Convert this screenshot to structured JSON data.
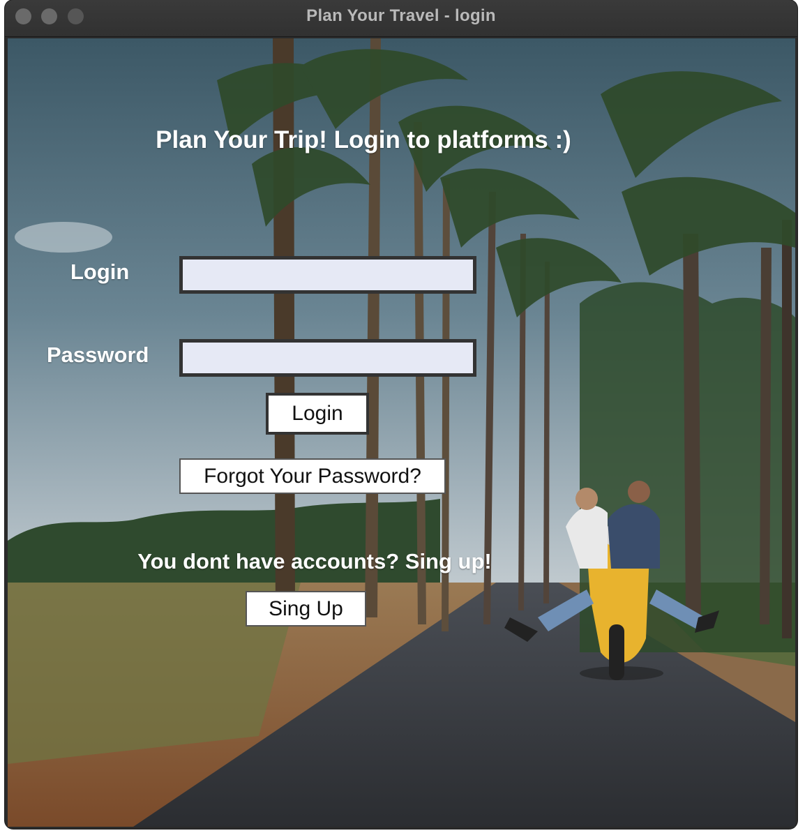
{
  "window": {
    "title": "Plan Your Travel - login"
  },
  "main": {
    "heading": "Plan Your Trip! Login to platforms :)",
    "login_label": "Login",
    "password_label": "Password",
    "login_value": "",
    "password_value": "",
    "login_button": "Login",
    "forgot_button": "Forgot Your Password?",
    "signup_prompt": "You dont have accounts? Sing up!",
    "signup_button": "Sing Up"
  },
  "colors": {
    "field_background": "#e6e9f5",
    "field_border": "#333333",
    "label_text": "#ffffff",
    "button_background": "#ffffff"
  },
  "icons": {
    "window_controls": [
      "close-icon",
      "minimize-icon",
      "zoom-icon"
    ]
  }
}
